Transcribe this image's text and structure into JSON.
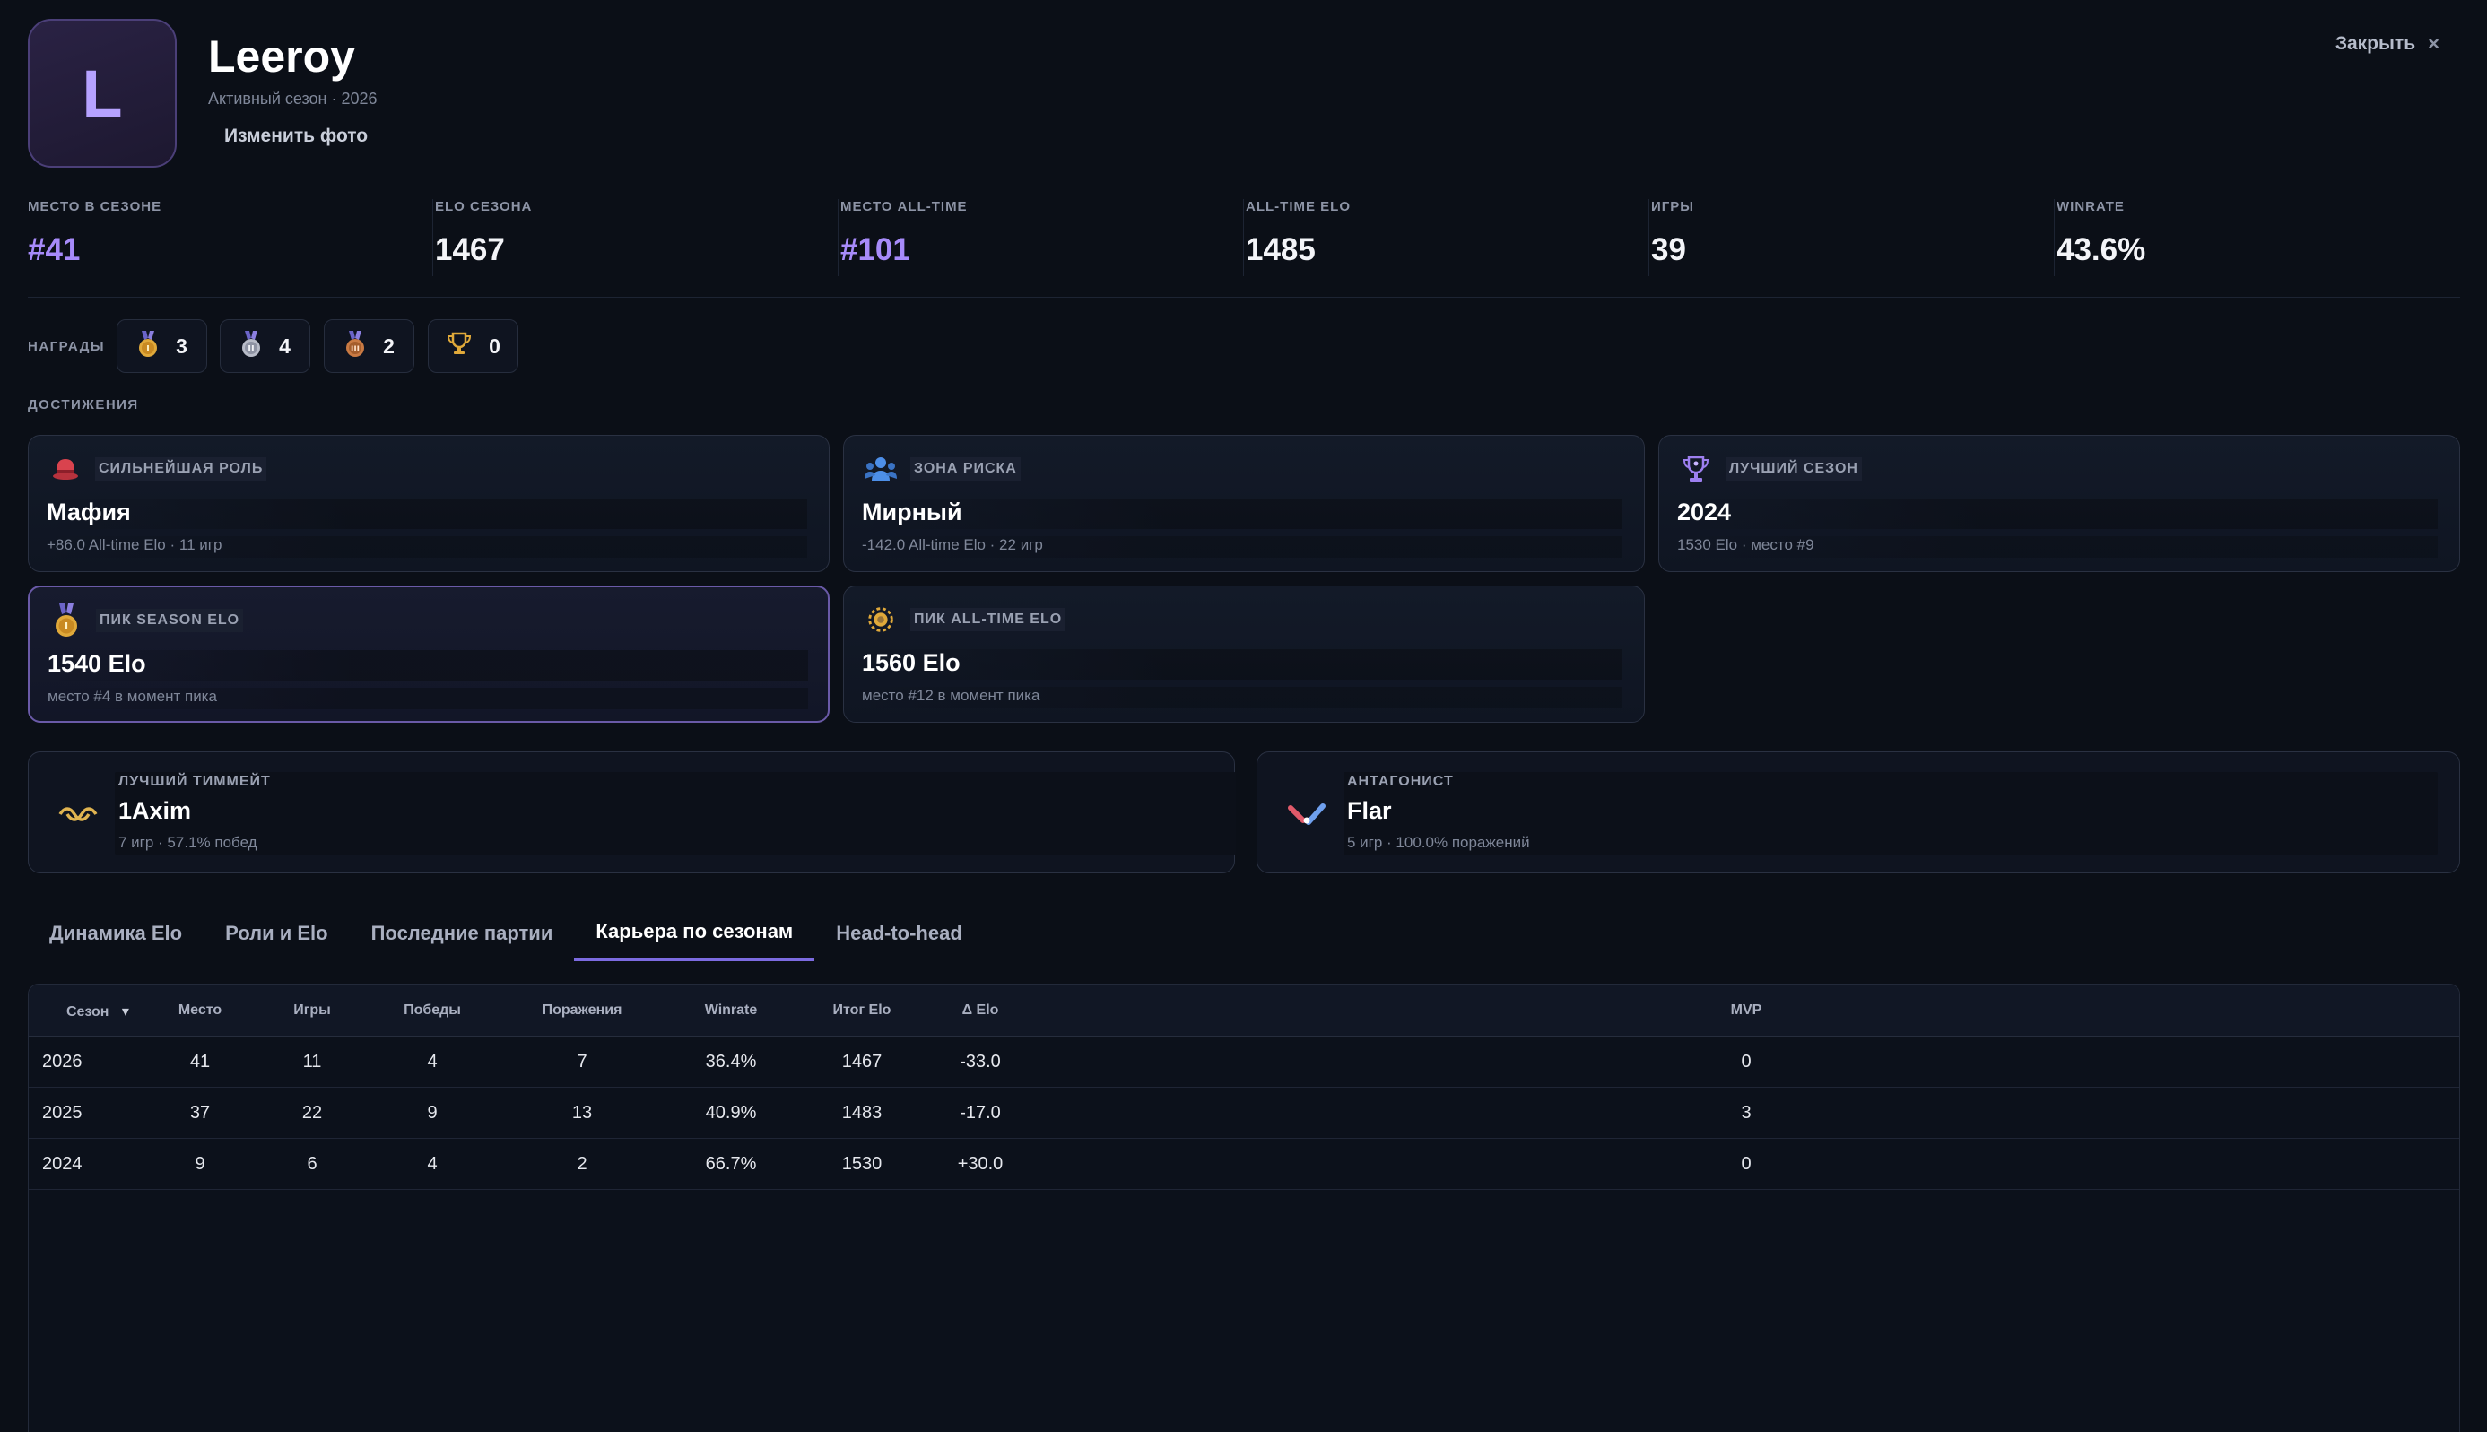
{
  "profile": {
    "initial": "L",
    "name": "Leeroy",
    "season_sub": "Активный сезон · 2026",
    "change_photo": "Изменить фото",
    "close_label": "Закрыть",
    "close_icon": "×"
  },
  "stats": [
    {
      "label": "МЕСТО В СЕЗОНЕ",
      "value": "#41"
    },
    {
      "label": "ELO СЕЗОНА",
      "value": "1467"
    },
    {
      "label": "МЕСТО ALL-TIME",
      "value": "#101"
    },
    {
      "label": "ALL-TIME ELO",
      "value": "1485"
    },
    {
      "label": "ИГРЫ",
      "value": "39"
    },
    {
      "label": "WINRATE",
      "value": "43.6%"
    }
  ],
  "awards": {
    "label": "НАГРАДЫ",
    "items": [
      {
        "icon": "gold-medal-icon",
        "count": "3"
      },
      {
        "icon": "silver-medal-icon",
        "count": "4"
      },
      {
        "icon": "bronze-medal-icon",
        "count": "2"
      },
      {
        "icon": "trophy-icon",
        "count": "0"
      }
    ]
  },
  "achievements": {
    "label": "ДОСТИЖЕНИЯ",
    "cards": [
      {
        "icon": "hat-icon",
        "title": "СИЛЬНЕЙШАЯ РОЛЬ",
        "main": "Мафия",
        "sub": "+86.0 All-time Elo · 11 игр"
      },
      {
        "icon": "people-icon",
        "title": "ЗОНА РИСКА",
        "main": "Мирный",
        "sub": "-142.0 All-time Elo · 22 игр"
      },
      {
        "icon": "purple-trophy-icon",
        "title": "ЛУЧШИЙ СЕЗОН",
        "main": "2024",
        "sub": "1530 Elo · место #9"
      },
      {
        "icon": "gold-medal-icon",
        "title": "ПИК SEASON ELO",
        "main": "1540 Elo",
        "sub": "место #4 в момент пика"
      },
      {
        "icon": "laurel-badge-icon",
        "title": "ПИК ALL-TIME ELO",
        "main": "1560 Elo",
        "sub": "место #12 в момент пика"
      }
    ]
  },
  "teammate": {
    "icon": "handshake-icon",
    "title": "ЛУЧШИЙ ТИММЕЙТ",
    "name": "1Axim",
    "sub": "7 игр  ·  57.1% побед"
  },
  "antagonist": {
    "icon": "crossed-swords-icon",
    "title": "АНТАГОНИСТ",
    "name": "Flar",
    "sub": "5 игр  ·  100.0% поражений"
  },
  "tabs": [
    "Динамика Elo",
    "Роли и Elo",
    "Последние партии",
    "Карьера по сезонам",
    "Head-to-head"
  ],
  "active_tab": "Карьера по сезонам",
  "table": {
    "headers": [
      "Сезон",
      "Место",
      "Игры",
      "Победы",
      "Поражения",
      "Winrate",
      "Итог Elo",
      "Δ Elo",
      "MVP"
    ],
    "sort_icon": "▾",
    "rows": [
      [
        "2026",
        "41",
        "11",
        "4",
        "7",
        "36.4%",
        "1467",
        "-33.0",
        "0"
      ],
      [
        "2025",
        "37",
        "22",
        "9",
        "13",
        "40.9%",
        "1483",
        "-17.0",
        "3"
      ],
      [
        "2024",
        "9",
        "6",
        "4",
        "2",
        "66.7%",
        "1530",
        "+30.0",
        "0"
      ]
    ]
  },
  "colors": {
    "accent": "#a78bfa",
    "background": "#0b0f17",
    "tab_underline": "#7c6be0"
  }
}
